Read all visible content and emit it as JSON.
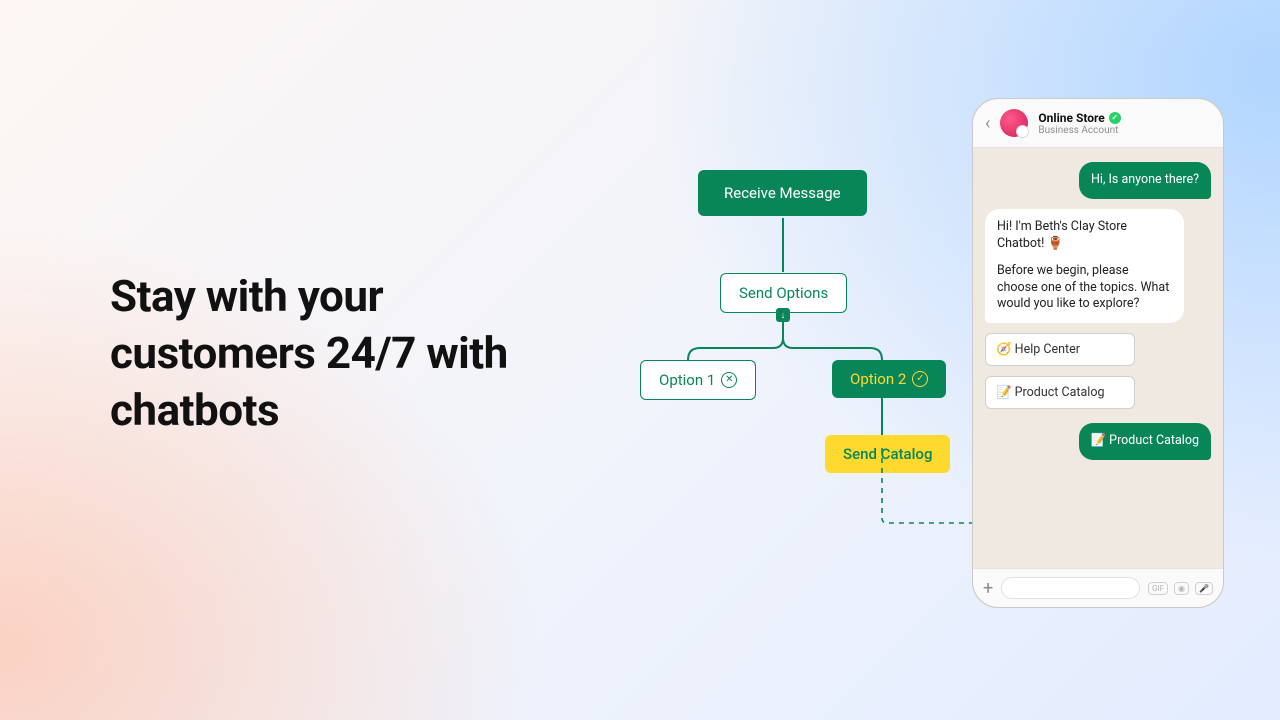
{
  "headline": "Stay with your customers 24/7 with chatbots",
  "flow": {
    "receive": "Receive Message",
    "sendOptions": "Send Options",
    "option1": "Option 1",
    "option2": "Option 2",
    "sendCatalog": "Send Catalog"
  },
  "phone": {
    "storeName": "Online Store",
    "storeSub": "Business Account",
    "userMsg": "Hi, Is anyone there?",
    "botMsg1": "Hi! I'm Beth's Clay Store Chatbot! 🏺",
    "botMsg2": "Before we begin, please choose one of the topics. What would you like to explore?",
    "reply1": "🧭 Help Center",
    "reply2": "📝 Product Catalog",
    "userChoice": "📝 Product Catalog"
  }
}
